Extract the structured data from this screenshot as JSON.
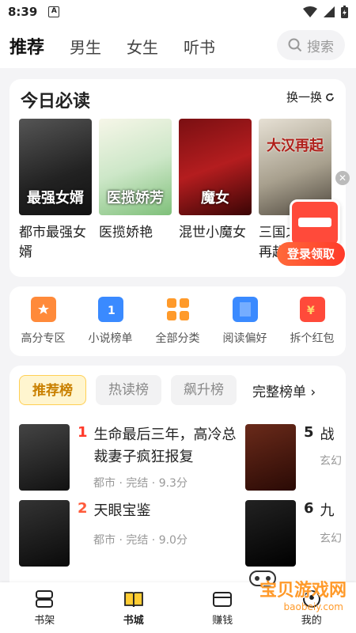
{
  "status": {
    "time": "8:39",
    "badge": "A"
  },
  "topnav": {
    "tabs": [
      {
        "label": "推荐",
        "active": true
      },
      {
        "label": "男生"
      },
      {
        "label": "女生"
      },
      {
        "label": "听书"
      }
    ],
    "search_label": "搜索"
  },
  "daily": {
    "title": "今日必读",
    "swap_label": "换一换",
    "books": [
      {
        "name": "都市最强女婿",
        "cover_text": "最强女婿"
      },
      {
        "name": "医揽娇艳",
        "cover_text": "医揽娇芳"
      },
      {
        "name": "混世小魔女",
        "cover_text": "魔女"
      },
      {
        "name": "三国之大汉再起",
        "cover_text": "大汉再起"
      }
    ],
    "promo_label": "登录领取"
  },
  "quick": [
    {
      "label": "高分专区",
      "color": "#ff8a3a"
    },
    {
      "label": "小说榜单",
      "color": "#3a8aff"
    },
    {
      "label": "全部分类",
      "color": "#ff9a2a"
    },
    {
      "label": "阅读偏好",
      "color": "#3a8aff"
    },
    {
      "label": "拆个红包",
      "color": "#ff4a3a"
    }
  ],
  "rank": {
    "tabs": [
      "推荐榜",
      "热读榜",
      "飙升榜"
    ],
    "full_label": "完整榜单",
    "items": [
      {
        "num": "1",
        "title": "生命最后三年，高冷总裁妻子疯狂报复",
        "meta": "都市 · 完结 · 9.3分"
      },
      {
        "num": "2",
        "title": "天眼宝鉴",
        "meta": "都市 · 完结 · 9.0分"
      },
      {
        "num": "5",
        "title": "战",
        "meta": "玄幻"
      },
      {
        "num": "6",
        "title": "九",
        "meta": "玄幻"
      }
    ]
  },
  "bottom": [
    {
      "label": "书架"
    },
    {
      "label": "书城",
      "active": true
    },
    {
      "label": "赚钱"
    },
    {
      "label": "我的"
    }
  ],
  "watermark": {
    "text": "宝贝游戏网",
    "url": "baobeiy.com"
  }
}
